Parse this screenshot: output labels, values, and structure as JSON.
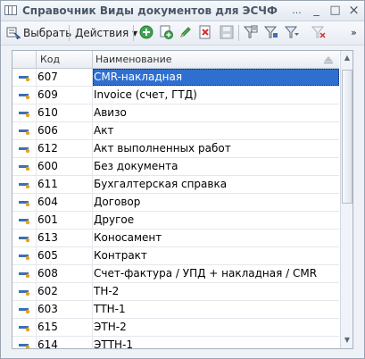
{
  "window": {
    "title": "Справочник Виды документов для ЭСЧФ",
    "more_label": "...",
    "min_glyph": "_",
    "max_glyph": "□",
    "close_glyph": "×"
  },
  "toolbar": {
    "select_label": "Выбрать",
    "actions_label": "Действия",
    "actions_arrow": "▾",
    "chevron": "»"
  },
  "grid": {
    "columns": [
      "Код",
      "Наименование"
    ],
    "rows": [
      {
        "code": "607",
        "name": "CMR-накладная",
        "selected": true
      },
      {
        "code": "609",
        "name": "Invoice (счет, ГТД)"
      },
      {
        "code": "610",
        "name": "Авизо"
      },
      {
        "code": "606",
        "name": "Акт"
      },
      {
        "code": "612",
        "name": "Акт выполненных работ"
      },
      {
        "code": "600",
        "name": "Без документа"
      },
      {
        "code": "611",
        "name": "Бухгалтерская справка"
      },
      {
        "code": "604",
        "name": "Договор"
      },
      {
        "code": "601",
        "name": "Другое"
      },
      {
        "code": "613",
        "name": "Коносамент"
      },
      {
        "code": "605",
        "name": "Контракт"
      },
      {
        "code": "608",
        "name": "Счет-фактура / УПД + накладная / CMR"
      },
      {
        "code": "602",
        "name": "ТН-2"
      },
      {
        "code": "603",
        "name": "ТТН-1"
      },
      {
        "code": "615",
        "name": "ЭТН-2"
      },
      {
        "code": "614",
        "name": "ЭТТН-1"
      }
    ]
  },
  "colors": {
    "selection": "#2f6fd0",
    "icon_bar": "#3b6fb8",
    "icon_dot": "#e8a11a"
  }
}
